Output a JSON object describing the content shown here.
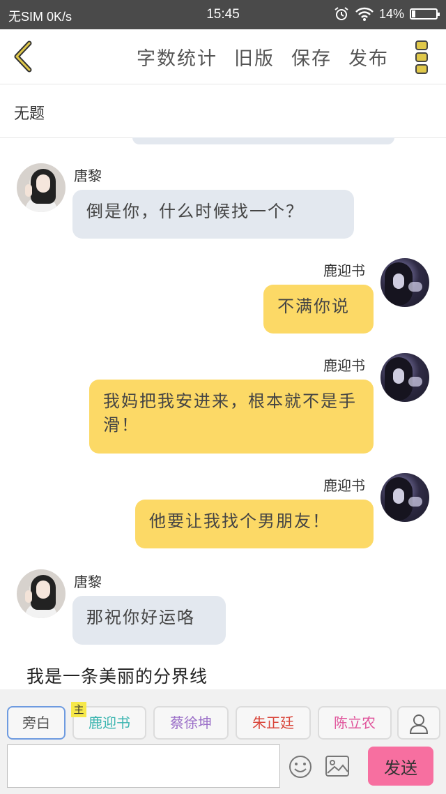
{
  "status_bar": {
    "carrier": "无SIM",
    "speed": "0K/s",
    "time": "15:45",
    "battery": "14%",
    "battery_level": 0.14,
    "icons": [
      "alarm-icon",
      "wifi-icon",
      "battery-icon"
    ]
  },
  "toolbar": {
    "back_icon": "chevron-left-icon",
    "actions": [
      "字数统计",
      "旧版",
      "保存",
      "发布"
    ],
    "more_icon": "more-vertical-icon",
    "accent_color": "#e0c84a"
  },
  "document": {
    "title": "无题"
  },
  "messages": [
    {
      "side": "left",
      "name": "唐黎",
      "text": "倒是你，什么时候找一个？"
    },
    {
      "side": "right",
      "name": "鹿迎书",
      "text": "不满你说"
    },
    {
      "side": "right",
      "name": "鹿迎书",
      "text": "我妈把我安进来，根本就不是手滑！"
    },
    {
      "side": "right",
      "name": "鹿迎书",
      "text": "他要让我找个男朋友！"
    },
    {
      "side": "left",
      "name": "唐黎",
      "text": "那祝你好运咯"
    }
  ],
  "divider_text": "我是一条美丽的分界线",
  "roles": [
    {
      "label": "旁白",
      "color": "#555555",
      "active": true
    },
    {
      "label": "鹿迎书",
      "color": "#3bb5b0",
      "badge": "主"
    },
    {
      "label": "蔡徐坤",
      "color": "#9b6fc8"
    },
    {
      "label": "朱正廷",
      "color": "#d9453a"
    },
    {
      "label": "陈立农",
      "color": "#e0549b"
    }
  ],
  "input": {
    "value": "",
    "placeholder": "",
    "emoji_icon": "emoji-icon",
    "image_icon": "image-icon",
    "send_label": "发送",
    "send_color": "#f76fa0"
  },
  "colors": {
    "bubble_left": "#e3e8ef",
    "bubble_right": "#fcd966"
  }
}
